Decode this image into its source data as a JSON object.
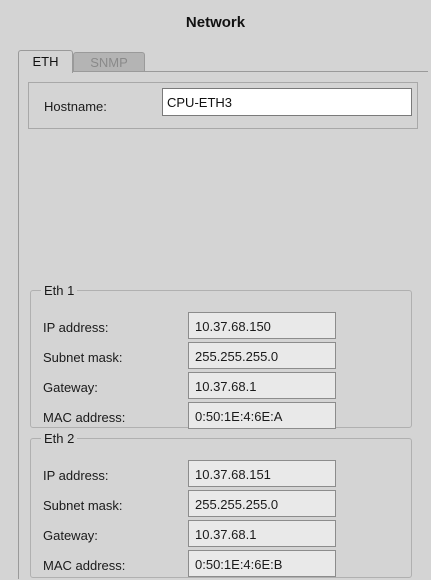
{
  "title": "Network",
  "tabs": [
    {
      "label": "ETH",
      "active": true
    },
    {
      "label": "SNMP",
      "active": false
    }
  ],
  "hostname": {
    "label": "Hostname:",
    "value": "CPU-ETH3"
  },
  "eth1": {
    "legend": "Eth 1",
    "rows": [
      {
        "label": "IP address:",
        "value": "10.37.68.150"
      },
      {
        "label": "Subnet mask:",
        "value": "255.255.255.0"
      },
      {
        "label": "Gateway:",
        "value": "10.37.68.1"
      },
      {
        "label": "MAC address:",
        "value": "0:50:1E:4:6E:A"
      }
    ]
  },
  "eth2": {
    "legend": "Eth 2",
    "rows": [
      {
        "label": "IP address:",
        "value": "10.37.68.151"
      },
      {
        "label": "Subnet mask:",
        "value": "255.255.255.0"
      },
      {
        "label": "Gateway:",
        "value": "10.37.68.1"
      },
      {
        "label": "MAC address:",
        "value": "0:50:1E:4:6E:B"
      }
    ]
  }
}
